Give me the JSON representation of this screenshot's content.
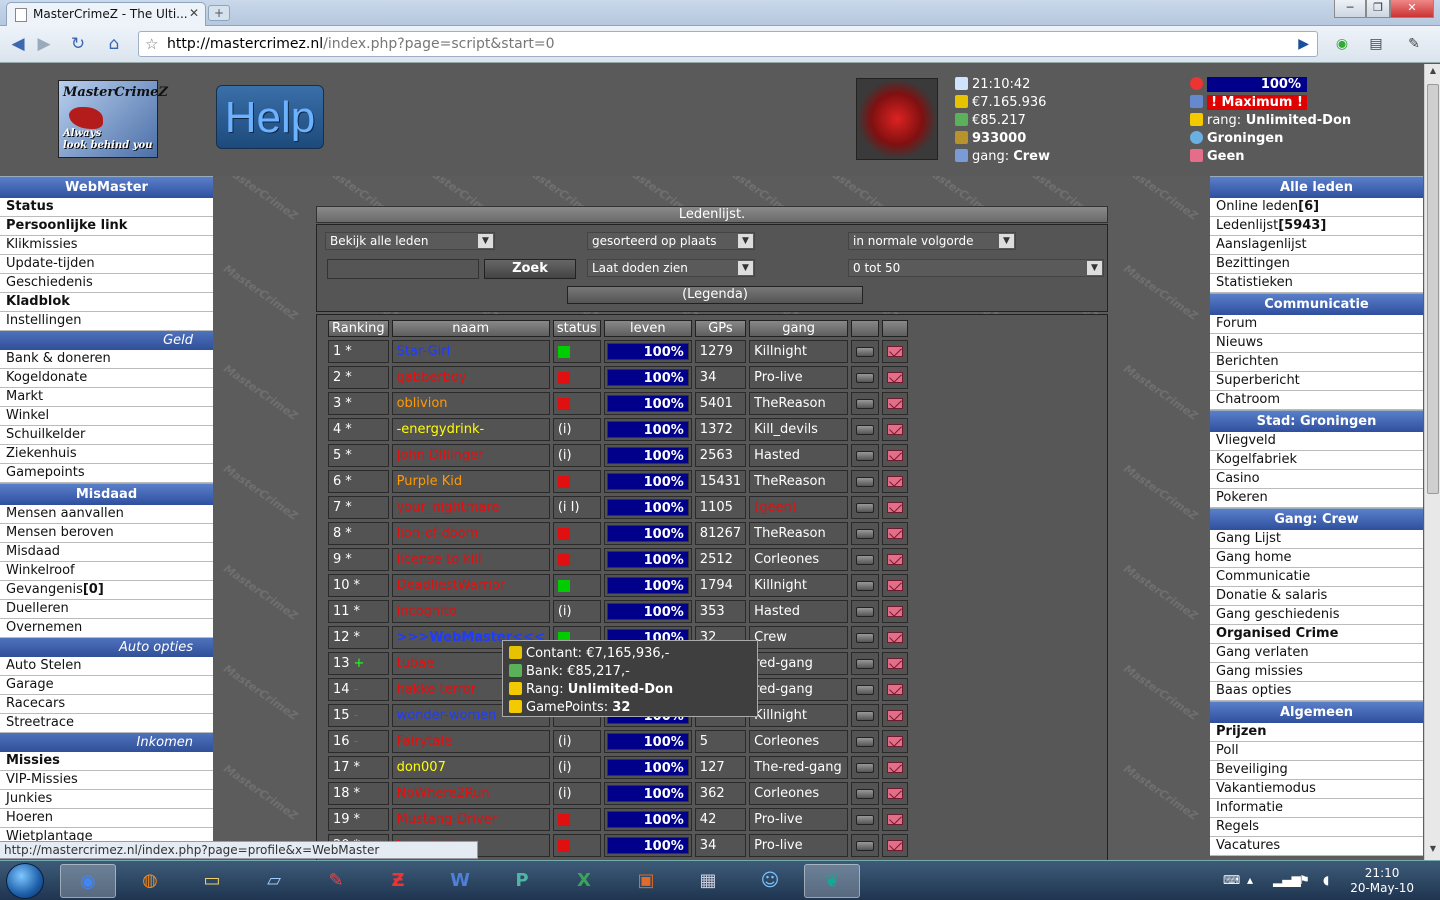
{
  "browser": {
    "tab_title": "MasterCrimeZ - The Ulti...",
    "url_host": "http://mastercrimez.nl",
    "url_rest": "/index.php?page=script&start=0",
    "status_url": "http://mastercrimez.nl/index.php?page=profile&x=WebMaster"
  },
  "header": {
    "logo_line1": "MasterCrimeZ",
    "logo_line2": "Always",
    "logo_line3": "look behind you",
    "help_label": "Help",
    "time": "21:10:42",
    "cash": "€7.165.936",
    "bank": "€85.217",
    "bullets": "933000",
    "gang_label": "gang:",
    "gang_value": "Crew",
    "health": "100%",
    "power": "! Maximum !",
    "rank_label": "rang:",
    "rank_value": "Unlimited-Don",
    "city": "Groningen",
    "messages": "Geen"
  },
  "left_menu": [
    {
      "type": "head",
      "label": "WebMaster"
    },
    {
      "type": "item",
      "label": "Status",
      "bold": true
    },
    {
      "type": "item",
      "label": "Persoonlijke link",
      "bold": true
    },
    {
      "type": "item",
      "label": "Klikmissies"
    },
    {
      "type": "item",
      "label": "Update-tijden"
    },
    {
      "type": "item",
      "label": "Geschiedenis"
    },
    {
      "type": "item",
      "label": "Kladblok",
      "bold": true
    },
    {
      "type": "item",
      "label": "Instellingen"
    },
    {
      "type": "sub",
      "label": "Geld"
    },
    {
      "type": "item",
      "label": "Bank & doneren"
    },
    {
      "type": "item",
      "label": "Kogeldonate"
    },
    {
      "type": "item",
      "label": "Markt"
    },
    {
      "type": "item",
      "label": "Winkel"
    },
    {
      "type": "item",
      "label": "Schuilkelder"
    },
    {
      "type": "item",
      "label": "Ziekenhuis"
    },
    {
      "type": "item",
      "label": "Gamepoints"
    },
    {
      "type": "head",
      "label": "Misdaad"
    },
    {
      "type": "item",
      "label": "Mensen aanvallen"
    },
    {
      "type": "item",
      "label": "Mensen beroven"
    },
    {
      "type": "item",
      "label": "Misdaad"
    },
    {
      "type": "item",
      "label": "Winkelroof"
    },
    {
      "type": "item",
      "label": "Gevangenis",
      "suffix": "[0]"
    },
    {
      "type": "item",
      "label": "Duelleren"
    },
    {
      "type": "item",
      "label": "Overnemen"
    },
    {
      "type": "sub",
      "label": "Auto opties"
    },
    {
      "type": "item",
      "label": "Auto Stelen"
    },
    {
      "type": "item",
      "label": "Garage"
    },
    {
      "type": "item",
      "label": "Racecars"
    },
    {
      "type": "item",
      "label": "Streetrace"
    },
    {
      "type": "sub",
      "label": "Inkomen"
    },
    {
      "type": "item",
      "label": "Missies",
      "bold": true
    },
    {
      "type": "item",
      "label": "VIP-Missies"
    },
    {
      "type": "item",
      "label": "Junkies"
    },
    {
      "type": "item",
      "label": "Hoeren"
    },
    {
      "type": "item",
      "label": "Wietplantage"
    }
  ],
  "right_menu": [
    {
      "type": "head",
      "label": "Alle leden"
    },
    {
      "type": "item",
      "label": "Online leden",
      "suffix": "[6]"
    },
    {
      "type": "item",
      "label": "Ledenlijst",
      "suffix": "[5943]"
    },
    {
      "type": "item",
      "label": "Aanslagenlijst"
    },
    {
      "type": "item",
      "label": "Bezittingen"
    },
    {
      "type": "item",
      "label": "Statistieken"
    },
    {
      "type": "head",
      "label": "Communicatie"
    },
    {
      "type": "item",
      "label": "Forum"
    },
    {
      "type": "item",
      "label": "Nieuws"
    },
    {
      "type": "item",
      "label": "Berichten"
    },
    {
      "type": "item",
      "label": "Superbericht"
    },
    {
      "type": "item",
      "label": "Chatroom"
    },
    {
      "type": "head",
      "label": "Stad: Groningen"
    },
    {
      "type": "item",
      "label": "Vliegveld"
    },
    {
      "type": "item",
      "label": "Kogelfabriek"
    },
    {
      "type": "item",
      "label": "Casino"
    },
    {
      "type": "item",
      "label": "Pokeren"
    },
    {
      "type": "head",
      "label": "Gang: Crew"
    },
    {
      "type": "item",
      "label": "Gang Lijst"
    },
    {
      "type": "item",
      "label": "Gang home"
    },
    {
      "type": "item",
      "label": "Communicatie"
    },
    {
      "type": "item",
      "label": "Donatie & salaris"
    },
    {
      "type": "item",
      "label": "Gang geschiedenis"
    },
    {
      "type": "item",
      "label": "Organised Crime",
      "bold": true
    },
    {
      "type": "item",
      "label": "Gang verlaten"
    },
    {
      "type": "item",
      "label": "Gang missies"
    },
    {
      "type": "item",
      "label": "Baas opties"
    },
    {
      "type": "head",
      "label": "Algemeen"
    },
    {
      "type": "item",
      "label": "Prijzen",
      "bold": true
    },
    {
      "type": "item",
      "label": "Poll"
    },
    {
      "type": "item",
      "label": "Beveiliging"
    },
    {
      "type": "item",
      "label": "Vakantiemodus"
    },
    {
      "type": "item",
      "label": "Informatie"
    },
    {
      "type": "item",
      "label": "Regels"
    },
    {
      "type": "item",
      "label": "Vacatures"
    }
  ],
  "list": {
    "title": "Ledenlijst.",
    "filter_show": "Bekijk alle leden",
    "filter_sort": "gesorteerd op plaats",
    "filter_order": "in normale volgorde",
    "filter_dead": "Laat doden zien",
    "filter_range": "0 tot 50",
    "search_button": "Zoek",
    "legenda_button": "(Legenda)",
    "columns": [
      "Ranking",
      "naam",
      "status",
      "leven",
      "GPs",
      "gang",
      "",
      ""
    ],
    "rows": [
      {
        "rank": "1",
        "mark": "*",
        "name": "Star-Girl",
        "name_color": "#1e3cff",
        "status": "green",
        "life": "100%",
        "gps": "1279",
        "gang": "Killnight",
        "gang_color": "#ffffff"
      },
      {
        "rank": "2",
        "mark": "*",
        "name": "gabberboy",
        "name_color": "#e01010",
        "status": "red",
        "life": "100%",
        "gps": "34",
        "gang": "Pro-live",
        "gang_color": "#ffffff"
      },
      {
        "rank": "3",
        "mark": "*",
        "name": "oblivion",
        "name_color": "#ff9a00",
        "status": "red",
        "life": "100%",
        "gps": "5401",
        "gang": "TheReason",
        "gang_color": "#ffffff"
      },
      {
        "rank": "4",
        "mark": "*",
        "name": "-energydrink-",
        "name_color": "#ffff00",
        "status": "(i)",
        "life": "100%",
        "gps": "1372",
        "gang": "Kill_devils",
        "gang_color": "#ffffff"
      },
      {
        "rank": "5",
        "mark": "*",
        "name": "John Dillinger",
        "name_color": "#e01010",
        "status": "(i)",
        "life": "100%",
        "gps": "2563",
        "gang": "Hasted",
        "gang_color": "#ffffff"
      },
      {
        "rank": "6",
        "mark": "*",
        "name": "Purple Kid",
        "name_color": "#ff9a00",
        "status": "red",
        "life": "100%",
        "gps": "15431",
        "gang": "TheReason",
        "gang_color": "#ffffff"
      },
      {
        "rank": "7",
        "mark": "*",
        "name": "your_nightmare",
        "name_color": "#e01010",
        "status": "(i I)",
        "life": "100%",
        "gps": "1105",
        "gang": "(geen)",
        "gang_color": "#e01010"
      },
      {
        "rank": "8",
        "mark": "*",
        "name": "lion-of-doom",
        "name_color": "#e01010",
        "status": "red",
        "life": "100%",
        "gps": "81267",
        "gang": "TheReason",
        "gang_color": "#ffffff"
      },
      {
        "rank": "9",
        "mark": "*",
        "name": "license to kill",
        "name_color": "#e01010",
        "status": "red",
        "life": "100%",
        "gps": "2512",
        "gang": "Corleones",
        "gang_color": "#ffffff"
      },
      {
        "rank": "10",
        "mark": "*",
        "name": "DeadliestWarrior",
        "name_color": "#e01010",
        "status": "green",
        "life": "100%",
        "gps": "1794",
        "gang": "Killnight",
        "gang_color": "#ffffff"
      },
      {
        "rank": "11",
        "mark": "*",
        "name": "incognito",
        "name_color": "#e01010",
        "status": "(i)",
        "life": "100%",
        "gps": "353",
        "gang": "Hasted",
        "gang_color": "#ffffff"
      },
      {
        "rank": "12",
        "mark": "*",
        "name": ">>>WebMaster<<<",
        "name_color": "#1e3cff",
        "status": "green",
        "life": "100%",
        "gps": "32",
        "gang": "Crew",
        "gang_color": "#ffffff"
      },
      {
        "rank": "13",
        "mark": "+",
        "name": "tubae",
        "name_color": "#e01010",
        "status": "",
        "life": "100%",
        "gps": "",
        "gang": "red-gang",
        "gang_color": "#ffffff"
      },
      {
        "rank": "14",
        "mark": "-",
        "name": "hakke terror",
        "name_color": "#e01010",
        "status": "",
        "life": "100%",
        "gps": "",
        "gang": "red-gang",
        "gang_color": "#ffffff"
      },
      {
        "rank": "15",
        "mark": "-",
        "name": "wonder-women",
        "name_color": "#1e3cff",
        "status": "",
        "life": "100%",
        "gps": "",
        "gang": "Killnight",
        "gang_color": "#ffffff"
      },
      {
        "rank": "16",
        "mark": "-",
        "name": "Fairytale",
        "name_color": "#e01010",
        "status": "(i)",
        "life": "100%",
        "gps": "5",
        "gang": "Corleones",
        "gang_color": "#ffffff"
      },
      {
        "rank": "17",
        "mark": "*",
        "name": "don007",
        "name_color": "#ffff00",
        "status": "(i)",
        "life": "100%",
        "gps": "127",
        "gang": "The-red-gang",
        "gang_color": "#ffffff"
      },
      {
        "rank": "18",
        "mark": "*",
        "name": "NoWhere2Run",
        "name_color": "#e01010",
        "status": "(i)",
        "life": "100%",
        "gps": "362",
        "gang": "Corleones",
        "gang_color": "#ffffff"
      },
      {
        "rank": "19",
        "mark": "*",
        "name": "Mustang-Driver",
        "name_color": "#e01010",
        "status": "red",
        "life": "100%",
        "gps": "42",
        "gang": "Pro-live",
        "gang_color": "#ffffff"
      },
      {
        "rank": "20",
        "mark": "*",
        "name": "Liquidation",
        "name_color": "#e01010",
        "status": "red",
        "life": "100%",
        "gps": "34",
        "gang": "Pro-live",
        "gang_color": "#ffffff"
      }
    ]
  },
  "tooltip": {
    "contant_label": "Contant:",
    "contant_value": "€7,165,936,-",
    "bank_label": "Bank:",
    "bank_value": "€85,217,-",
    "rang_label": "Rang:",
    "rang_value": "Unlimited-Don",
    "gp_label": "GamePoints:",
    "gp_value": "32"
  },
  "watermark": "MasterCrimeZ",
  "taskbar": {
    "time": "21:10",
    "date": "20-May-10"
  }
}
